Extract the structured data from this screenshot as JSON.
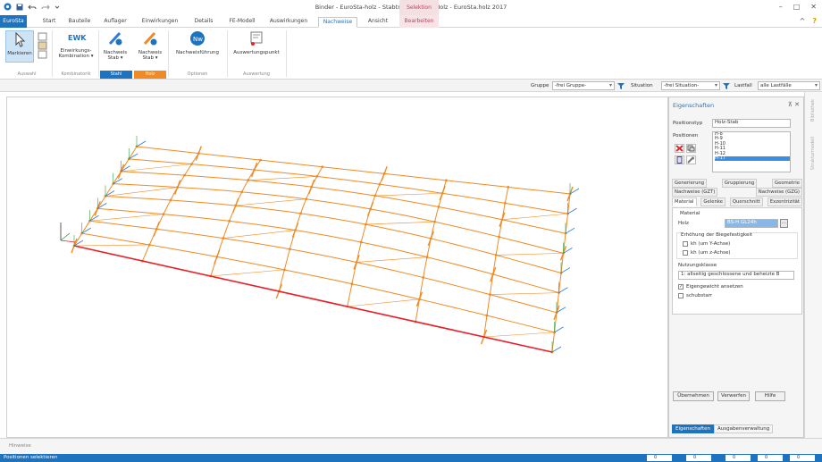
{
  "window": {
    "title": "Binder - EuroSta-holz - Stabtragwerk aus Holz - EuroSta.holz 2017",
    "context_tab": "Selektion",
    "controls": [
      "–",
      "□",
      "✕"
    ]
  },
  "tabs": [
    {
      "label": "EuroSta",
      "kind": "file"
    },
    {
      "label": "Start"
    },
    {
      "label": "Bauteile"
    },
    {
      "label": "Auflager"
    },
    {
      "label": "Einwirkungen"
    },
    {
      "label": "Details"
    },
    {
      "label": "FE-Modell"
    },
    {
      "label": "Auswirkungen"
    },
    {
      "label": "Nachweise",
      "kind": "active"
    },
    {
      "label": "Ansicht"
    },
    {
      "label": "Bearbeiten",
      "kind": "ctx"
    }
  ],
  "ribbon_help": "?",
  "ribbon": {
    "markieren": "Markieren",
    "ewk_title": "EWK",
    "ewk": "Einwirkungs-\nKombination ▾",
    "stab1": "Nachweis\nStab ▾",
    "stab2": "Nachweis\nStab ▾",
    "nachweisfuehrung": "Nachweisführung",
    "auswertungspunkt": "Auswertungspunkt",
    "groups": {
      "auswahl": "Auswahl",
      "kombinatorik": "Kombinatorik",
      "stahl": "Stahl",
      "holz": "Holz",
      "optionen": "Optionen",
      "auswertung": "Auswertung"
    }
  },
  "toolbar": {
    "gruppe_label": "Gruppe",
    "gruppe_value": "-frei Gruppe-",
    "situation_label": "Situation",
    "situation_value": "-frei Situation-",
    "lastfall_label": "Lastfall",
    "lastfall_value": "alle Lastfälle"
  },
  "sidebar": {
    "item1": "Bibliothek",
    "item2": "Strukturmodell"
  },
  "panel": {
    "title": "Eigenschaften",
    "pin": "⊼ ✕",
    "positionstyp_label": "Positionstyp",
    "positionstyp_value": "Holz-Stab",
    "positionen_label": "Positionen",
    "positionen": [
      "H-8",
      "H-9",
      "H-10",
      "H-11",
      "H-12",
      "H-17"
    ],
    "tabs_row1": [
      "Generierung",
      "Gruppierung",
      "Geometrie"
    ],
    "tabs_row2": [
      "Nachweise (GZT)",
      "Nachweise (GZG)"
    ],
    "tabs_row3": [
      "Material",
      "Gelenke",
      "Querschnitt",
      "Exzentrizität"
    ],
    "material_label": "Material",
    "holz_label": "Holz",
    "holz_value": "BS-H GL24h",
    "erh_label": "Erhöhung der Biegefestigkeit",
    "kh_y": "kh (um Y-Achse)",
    "kh_z": "kh (um z-Achse)",
    "nk_label": "Nutzungsklasse",
    "nk_value": "1: allseitig geschlossene und beheizte B",
    "eigengewicht": "Eigengewicht ansetzen",
    "schubstarr": "schubstarr",
    "btn_uebernehmen": "Übernehmen",
    "btn_verwerfen": "Verwerfen",
    "btn_hilfe": "Hilfe",
    "bottom_tab1": "Eigenschaften",
    "bottom_tab2": "Ausgabenverwaltung"
  },
  "hinweise": "Hinweise",
  "status": {
    "text": "Positionen selektieren",
    "v1": "0",
    "v2": "0",
    "v3": "0",
    "v4": "0",
    "v5": "0"
  },
  "colors": {
    "accent": "#1e73be",
    "beam": "#f08a24",
    "edge": "#e8202a",
    "support": "#2e7be0"
  }
}
